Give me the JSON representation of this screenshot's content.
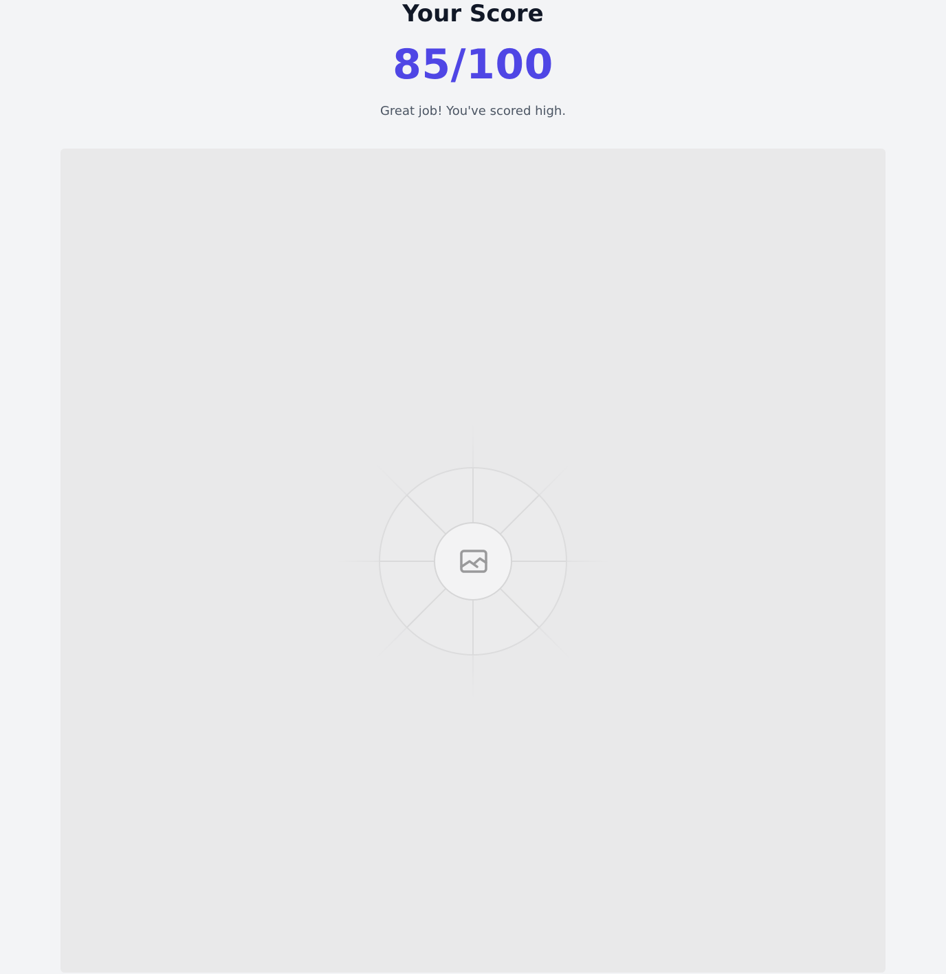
{
  "score": {
    "title": "Your Score",
    "value": "85/100",
    "message": "Great job! You've scored high."
  },
  "colors": {
    "background": "#f3f4f6",
    "title": "#111827",
    "accent": "#4f46e5",
    "message": "#4b5563",
    "placeholder": "#e9e9ea"
  },
  "image": {
    "icon": "image-icon"
  }
}
